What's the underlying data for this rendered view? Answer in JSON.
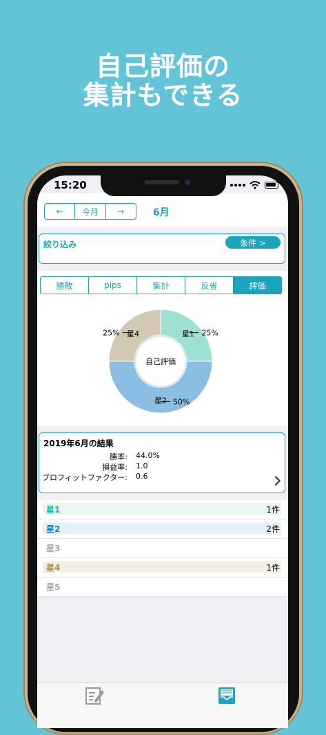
{
  "promo": {
    "line1": "自己評価の",
    "line2": "集計もできる"
  },
  "status_bar": {
    "time": "15:20"
  },
  "nav": {
    "prev": "←",
    "current": "今月",
    "next": "→",
    "month": "6月"
  },
  "filter": {
    "label": "絞り込み",
    "condition_button": "条件 >"
  },
  "tabs": [
    "勝敗",
    "pips",
    "集計",
    "反省",
    "評価"
  ],
  "active_tab": "評価",
  "chart_data": {
    "type": "pie",
    "center_label": "自己評価",
    "slices": [
      {
        "label": "星1",
        "percent_label": "25%",
        "value": 25,
        "color": "#9fe0d5"
      },
      {
        "label": "星2",
        "percent_label": "50%",
        "value": 50,
        "color": "#8cbde3"
      },
      {
        "label": "星4",
        "percent_label": "25%",
        "value": 25,
        "color": "#d3c8b3"
      }
    ]
  },
  "summary": {
    "title": "2019年6月の結果",
    "stats": [
      {
        "label": "勝率:",
        "value": "44.0%"
      },
      {
        "label": "損益率:",
        "value": "1.0"
      },
      {
        "label": "プロフィットファクター:",
        "value": "0.6"
      }
    ]
  },
  "star_list": [
    {
      "label": "星1",
      "count": "1件",
      "label_color": "#1fb7a0",
      "bar_color": "#e8f7f4",
      "bar_fraction": 1.0
    },
    {
      "label": "星2",
      "count": "2件",
      "label_color": "#1a7fc4",
      "bar_color": "#e5f0fa",
      "bar_fraction": 1.0
    },
    {
      "label": "星3",
      "count": "",
      "label_color": "#a8a8a8",
      "bar_color": "#ffffff",
      "bar_fraction": 0
    },
    {
      "label": "星4",
      "count": "1件",
      "label_color": "#a5895a",
      "bar_color": "#f3efe7",
      "bar_fraction": 1.0
    },
    {
      "label": "星5",
      "count": "",
      "label_color": "#a8a8a8",
      "bar_color": "#ffffff",
      "bar_fraction": 0
    }
  ],
  "tabbar": {
    "items": [
      {
        "icon": "journal-edit-icon"
      },
      {
        "icon": "report-tray-icon"
      }
    ]
  }
}
